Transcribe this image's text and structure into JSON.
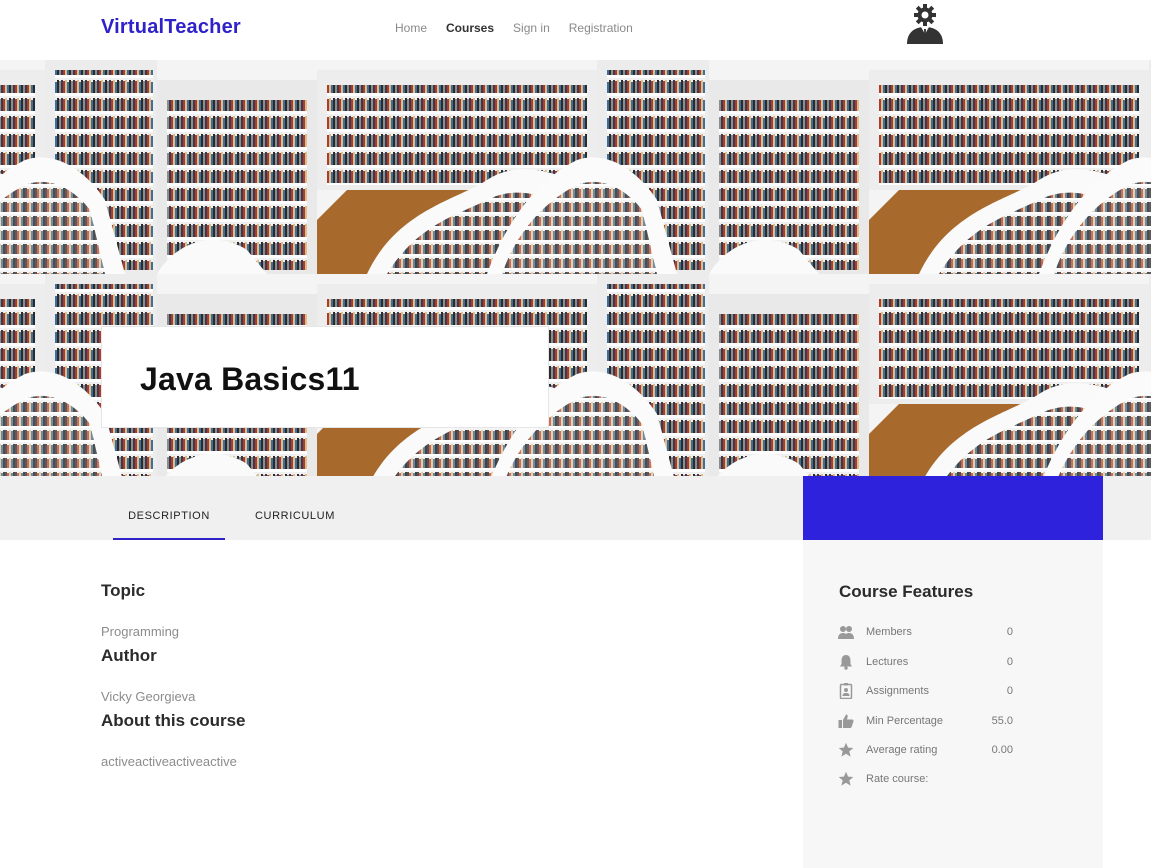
{
  "header": {
    "logo": "VirtualTeacher",
    "nav": [
      {
        "label": "Home",
        "active": false
      },
      {
        "label": "Courses",
        "active": true
      },
      {
        "label": "Sign in",
        "active": false
      },
      {
        "label": "Registration",
        "active": false
      }
    ],
    "avatar_icon": "user-gear-avatar-icon"
  },
  "course": {
    "title": "Java Basics11"
  },
  "tabs": [
    {
      "label": "DESCRIPTION",
      "active": true
    },
    {
      "label": "CURRICULUM",
      "active": false
    }
  ],
  "description": {
    "topic_heading": "Topic",
    "topic_value": "Programming",
    "author_heading": "Author",
    "author_value": "Vicky Georgieva",
    "about_heading": "About this course",
    "about_value": "activeactiveactiveactive"
  },
  "features": {
    "title": "Course Features",
    "rows": [
      {
        "icon": "members-icon",
        "label": "Members",
        "value": "0"
      },
      {
        "icon": "bell-icon",
        "label": "Lectures",
        "value": "0"
      },
      {
        "icon": "badge-icon",
        "label": "Assignments",
        "value": "0"
      },
      {
        "icon": "thumbs-up-icon",
        "label": "Min Percentage",
        "value": "55.0"
      },
      {
        "icon": "star-icon",
        "label": "Average rating",
        "value": "0.00"
      },
      {
        "icon": "star-icon",
        "label": "Rate course:",
        "value": ""
      }
    ]
  },
  "colors": {
    "brand": "#2f22c8",
    "feature_header": "#2f22dd"
  }
}
